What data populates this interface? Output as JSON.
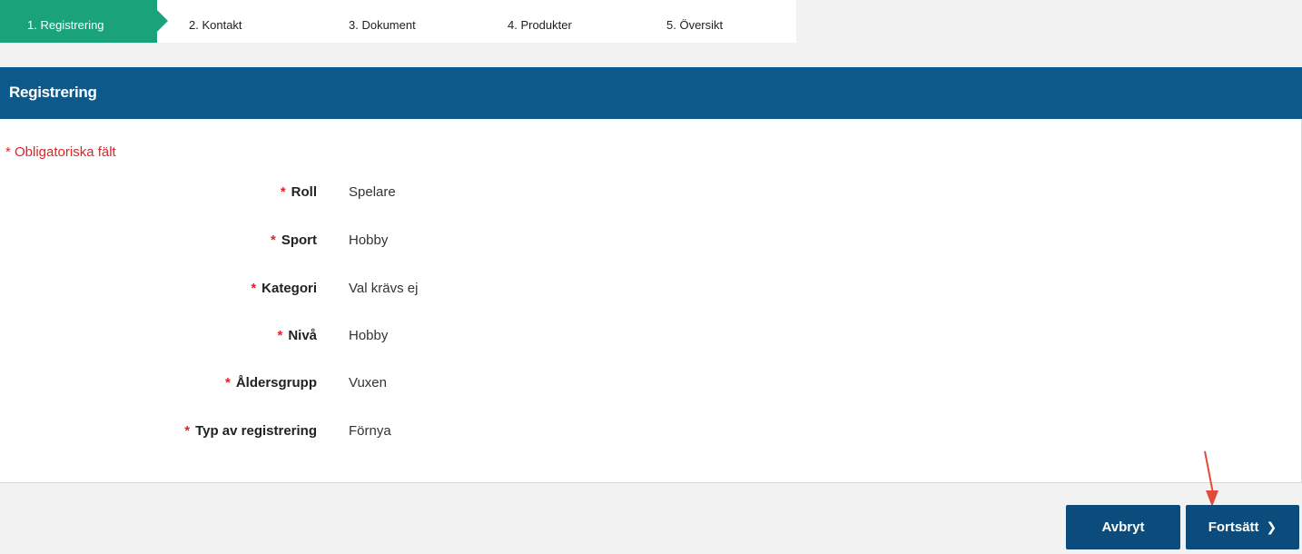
{
  "stepper": {
    "steps": [
      {
        "label": "1. Registrering",
        "active": true
      },
      {
        "label": "2. Kontakt",
        "active": false
      },
      {
        "label": "3. Dokument",
        "active": false
      },
      {
        "label": "4. Produkter",
        "active": false
      },
      {
        "label": "5. Översikt",
        "active": false
      }
    ]
  },
  "panel": {
    "title": "Registrering",
    "required_note": "* Obligatoriska fält",
    "required_star": "*",
    "fields": [
      {
        "label": "Roll",
        "value": "Spelare"
      },
      {
        "label": "Sport",
        "value": "Hobby"
      },
      {
        "label": "Kategori",
        "value": "Val krävs ej"
      },
      {
        "label": "Nivå",
        "value": "Hobby"
      },
      {
        "label": "Åldersgrupp",
        "value": "Vuxen"
      },
      {
        "label": "Typ av registrering",
        "value": "Förnya"
      }
    ]
  },
  "actions": {
    "cancel_label": "Avbryt",
    "continue_label": "Fortsätt",
    "continue_icon": "chevron-right-icon"
  },
  "colors": {
    "active_step": "#1aa37a",
    "header": "#0c5a8c",
    "button": "#0c4c7c",
    "required": "#e32326"
  }
}
